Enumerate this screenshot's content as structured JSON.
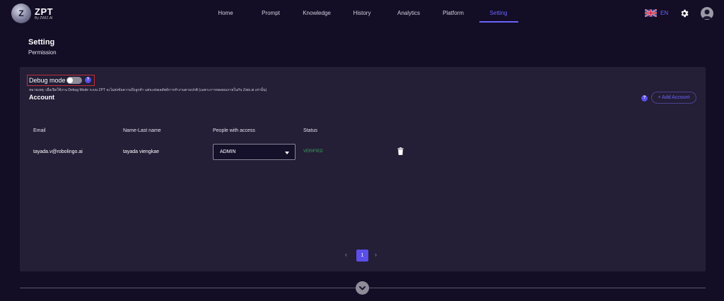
{
  "brand": {
    "logo_letter": "Z",
    "title": "ZPT",
    "subtitle": "By ZWIZ.AI"
  },
  "nav": {
    "items": [
      {
        "label": "Home"
      },
      {
        "label": "Prompt"
      },
      {
        "label": "Knowledge"
      },
      {
        "label": "History"
      },
      {
        "label": "Analytics"
      },
      {
        "label": "Platform"
      },
      {
        "label": "Setting"
      }
    ],
    "active": "Setting",
    "language": "EN"
  },
  "header": {
    "title": "Setting",
    "subtitle": "Permission"
  },
  "debug": {
    "label": "Debug mode",
    "enabled": false,
    "help": "?",
    "note": "หมายเหตุ: เมื่อเปิดใช้งาน Debug Mode ระบบ ZPT จะไม่ส่งข้อความถึงลูกค้า แต่จะส่งผลลัพธ์การทำงานตามปกติ (เฉพาะการทดสอบภายในกับ Zwiz.ai เท่านั้น)"
  },
  "account": {
    "title": "Account",
    "help": "?",
    "add_label": "+ Add Account",
    "columns": [
      "Email",
      "Name-Last name",
      "People with access",
      "Status"
    ],
    "rows": [
      {
        "email": "tayada.v@robolingo.ai",
        "name": "tayada viengkae",
        "access": "ADMIN",
        "status": "VERIFIED"
      }
    ]
  },
  "pagination": {
    "prev": "‹",
    "current": "1",
    "next": "›"
  },
  "colors": {
    "accent": "#6b63ff",
    "verified": "#3aa55c",
    "panel": "#241e36",
    "background": "#130d25"
  }
}
